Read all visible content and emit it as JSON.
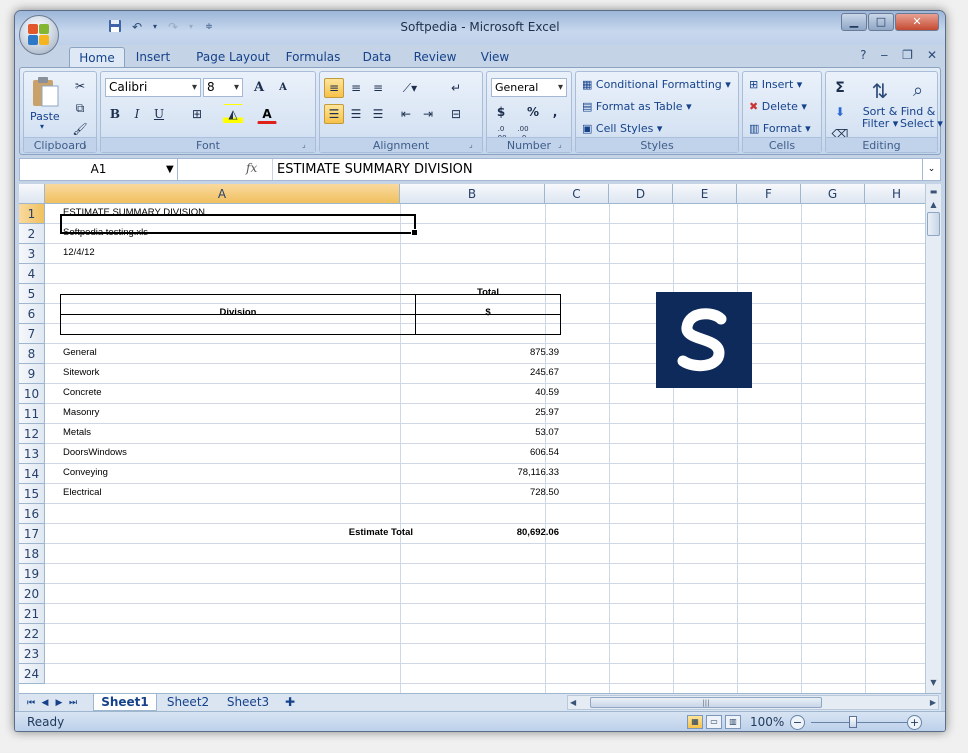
{
  "window": {
    "title": "Softpedia - Microsoft Excel"
  },
  "qat": {
    "save_icon": "save-icon",
    "undo_icon": "undo-icon",
    "redo_icon": "redo-icon",
    "customize_icon": "customize-qat-icon"
  },
  "window_controls": {
    "minimize": "▁",
    "maximize": "□",
    "close": "✕"
  },
  "ribbon_tabs": [
    "Home",
    "Insert",
    "Page Layout",
    "Formulas",
    "Data",
    "Review",
    "View"
  ],
  "ribbon": {
    "clipboard": {
      "label": "Clipboard",
      "paste": "Paste"
    },
    "font": {
      "label": "Font",
      "font_name": "Calibri",
      "font_size": "8",
      "bold": "B",
      "italic": "I",
      "underline": "U",
      "grow": "A",
      "shrink": "A",
      "font_color": "A"
    },
    "alignment": {
      "label": "Alignment"
    },
    "number": {
      "label": "Number",
      "format": "General",
      "currency": "$",
      "percent": "%",
      "comma": ",",
      "inc_dec": ".0 .00",
      "dec_dec": ".00 .0"
    },
    "styles": {
      "label": "Styles",
      "conditional": "Conditional Formatting",
      "format_table": "Format as Table",
      "cell_styles": "Cell Styles"
    },
    "cells": {
      "label": "Cells",
      "insert": "Insert",
      "delete": "Delete",
      "format": "Format"
    },
    "editing": {
      "label": "Editing",
      "sum": "Σ",
      "sort1": "Sort &",
      "sort2": "Filter",
      "find1": "Find &",
      "find2": "Select"
    }
  },
  "formula_bar": {
    "name_box": "A1",
    "fx": "fx",
    "content": "ESTIMATE SUMMARY DIVISION"
  },
  "columns": [
    "A",
    "B",
    "C",
    "D",
    "E",
    "F",
    "G",
    "H"
  ],
  "rows": [
    "1",
    "2",
    "3",
    "4",
    "5",
    "6",
    "7",
    "8",
    "9",
    "10",
    "11",
    "12",
    "13",
    "14",
    "15",
    "16",
    "17",
    "18",
    "19",
    "20",
    "21",
    "22",
    "23",
    "24"
  ],
  "cells": {
    "a1": "ESTIMATE SUMMARY DIVISION",
    "a2": "Softpedia testing.xls",
    "a3": "12/4/12",
    "b5": "Total",
    "a6": "Division",
    "b6": "$",
    "divisions": [
      {
        "name": "General",
        "value": "875.39"
      },
      {
        "name": "Sitework",
        "value": "245.67"
      },
      {
        "name": "Concrete",
        "value": "40.59"
      },
      {
        "name": "Masonry",
        "value": "25.97"
      },
      {
        "name": "Metals",
        "value": "53.07"
      },
      {
        "name": "DoorsWindows",
        "value": "606.54"
      },
      {
        "name": "Conveying",
        "value": "78,116.33"
      },
      {
        "name": "Electrical",
        "value": "728.50"
      }
    ],
    "total_label": "Estimate Total",
    "total_value": "80,692.06"
  },
  "image": {
    "letter": "S",
    "bg": "#0d2a5a"
  },
  "sheets": [
    "Sheet1",
    "Sheet2",
    "Sheet3"
  ],
  "status": {
    "text": "Ready",
    "zoom": "100%"
  },
  "colors": {
    "accent": "#15428b",
    "selection": "#f1c15f",
    "ribbon": "#d3e0f0"
  }
}
